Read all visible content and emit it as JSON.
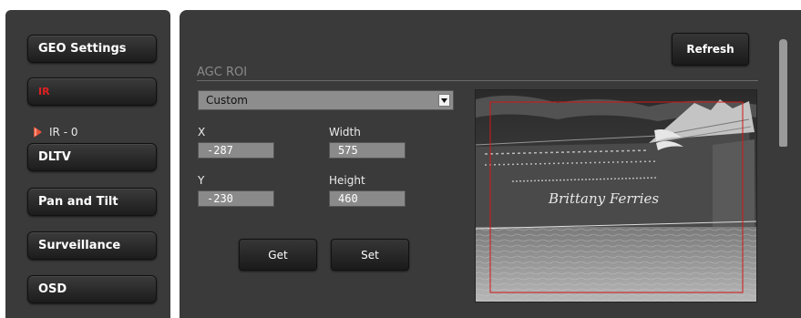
{
  "sidebar": {
    "items": [
      {
        "label": "GEO Settings"
      },
      {
        "label": "IR"
      },
      {
        "label": "DLTV"
      },
      {
        "label": "Pan and Tilt"
      },
      {
        "label": "Surveillance"
      },
      {
        "label": "OSD"
      }
    ],
    "sub_item": {
      "label": "IR - 0"
    }
  },
  "toolbar": {
    "refresh_label": "Refresh"
  },
  "agc_roi": {
    "section_title": "AGC ROI",
    "mode_selected": "Custom",
    "x_label": "X",
    "x_value": "-287",
    "width_label": "Width",
    "width_value": "575",
    "y_label": "Y",
    "y_value": "-230",
    "height_label": "Height",
    "height_value": "460",
    "get_label": "Get",
    "set_label": "Set"
  },
  "preview": {
    "ship_text": "Brittany Ferries",
    "roi_color": "#d01818"
  },
  "colors": {
    "panel_bg": "#3a3a3a",
    "active_nav": "#e02020"
  }
}
